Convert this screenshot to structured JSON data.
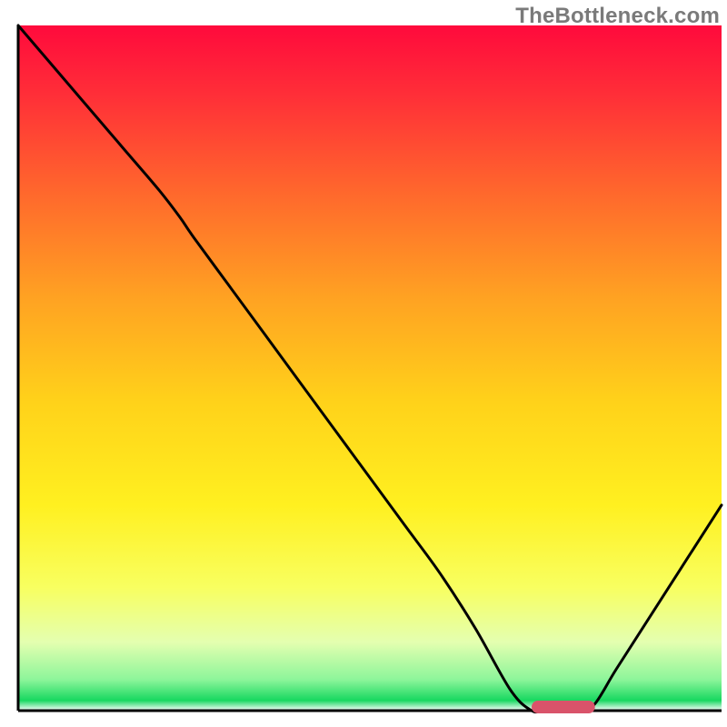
{
  "attribution": "TheBottleneck.com",
  "chart_data": {
    "type": "line",
    "title": "",
    "xlabel": "",
    "ylabel": "",
    "xlim": [
      0,
      100
    ],
    "ylim": [
      0,
      100
    ],
    "x": [
      0,
      5,
      10,
      15,
      20,
      23,
      25,
      30,
      35,
      40,
      45,
      50,
      55,
      60,
      65,
      70,
      73,
      75,
      80,
      82,
      85,
      90,
      95,
      100
    ],
    "values": [
      100,
      94,
      88,
      82,
      76,
      72,
      69,
      62,
      55,
      48,
      41,
      34,
      27,
      20,
      12,
      3,
      0,
      0,
      0,
      1,
      6,
      14,
      22,
      30
    ],
    "marker": {
      "x_start": 73,
      "x_end": 82,
      "y": 0
    },
    "gradient_stops": [
      {
        "offset": 0.0,
        "color": "#ff0a3c"
      },
      {
        "offset": 0.1,
        "color": "#ff2e38"
      },
      {
        "offset": 0.25,
        "color": "#ff6a2c"
      },
      {
        "offset": 0.4,
        "color": "#ffa322"
      },
      {
        "offset": 0.55,
        "color": "#ffd21a"
      },
      {
        "offset": 0.7,
        "color": "#fff020"
      },
      {
        "offset": 0.82,
        "color": "#f8ff60"
      },
      {
        "offset": 0.9,
        "color": "#e4ffb0"
      },
      {
        "offset": 0.955,
        "color": "#8cf59a"
      },
      {
        "offset": 0.985,
        "color": "#18d860"
      },
      {
        "offset": 1.0,
        "color": "#ffffff"
      }
    ],
    "marker_color": "#d9536a",
    "axis_color": "#000000"
  }
}
